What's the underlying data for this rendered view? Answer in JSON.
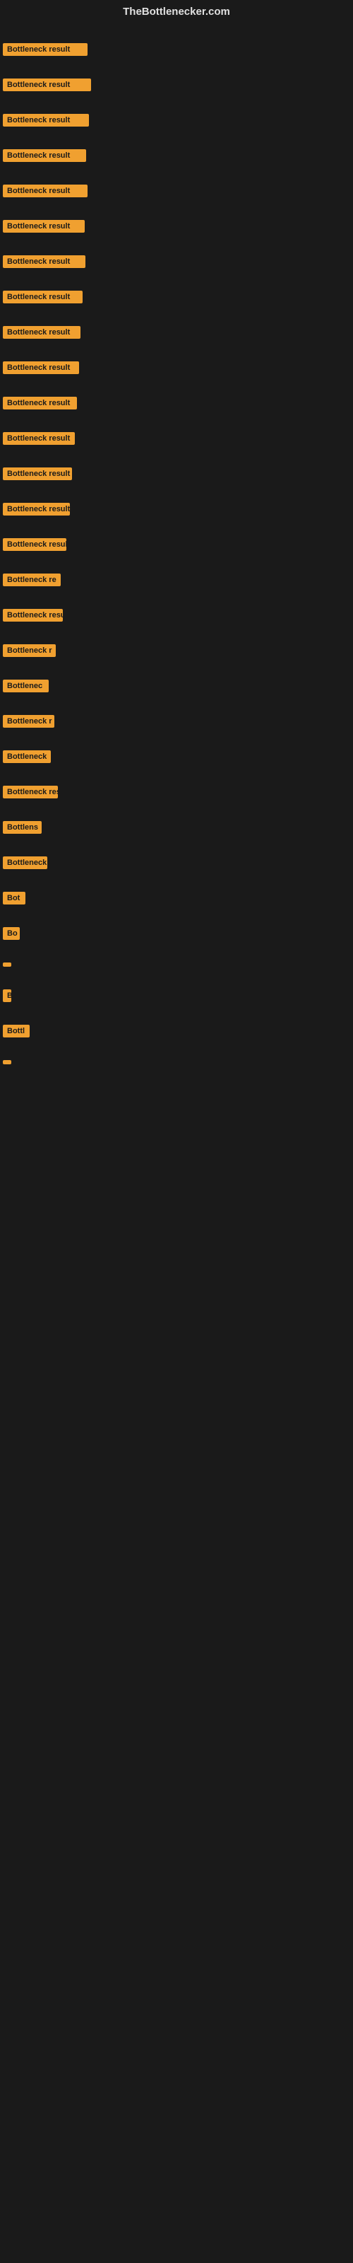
{
  "header": {
    "title": "TheBottlenecker.com"
  },
  "items": [
    {
      "label": "Bottleneck result",
      "width": 120
    },
    {
      "label": "Bottleneck result",
      "width": 125
    },
    {
      "label": "Bottleneck result",
      "width": 122
    },
    {
      "label": "Bottleneck result",
      "width": 118
    },
    {
      "label": "Bottleneck result",
      "width": 120
    },
    {
      "label": "Bottleneck result",
      "width": 116
    },
    {
      "label": "Bottleneck result",
      "width": 117
    },
    {
      "label": "Bottleneck result",
      "width": 113
    },
    {
      "label": "Bottleneck result",
      "width": 110
    },
    {
      "label": "Bottleneck result",
      "width": 108
    },
    {
      "label": "Bottleneck result",
      "width": 105
    },
    {
      "label": "Bottleneck result",
      "width": 102
    },
    {
      "label": "Bottleneck result",
      "width": 98
    },
    {
      "label": "Bottleneck result",
      "width": 95
    },
    {
      "label": "Bottleneck result",
      "width": 90
    },
    {
      "label": "Bottleneck re",
      "width": 82
    },
    {
      "label": "Bottleneck result",
      "width": 85
    },
    {
      "label": "Bottleneck r",
      "width": 75
    },
    {
      "label": "Bottlenec",
      "width": 65
    },
    {
      "label": "Bottleneck r",
      "width": 73
    },
    {
      "label": "Bottleneck",
      "width": 68
    },
    {
      "label": "Bottleneck res",
      "width": 78
    },
    {
      "label": "Bottlens",
      "width": 55
    },
    {
      "label": "Bottleneck",
      "width": 63
    },
    {
      "label": "Bot",
      "width": 32
    },
    {
      "label": "Bo",
      "width": 24
    },
    {
      "label": "",
      "width": 10
    },
    {
      "label": "B",
      "width": 12
    },
    {
      "label": "Bottl",
      "width": 38
    },
    {
      "label": "",
      "width": 8
    }
  ]
}
